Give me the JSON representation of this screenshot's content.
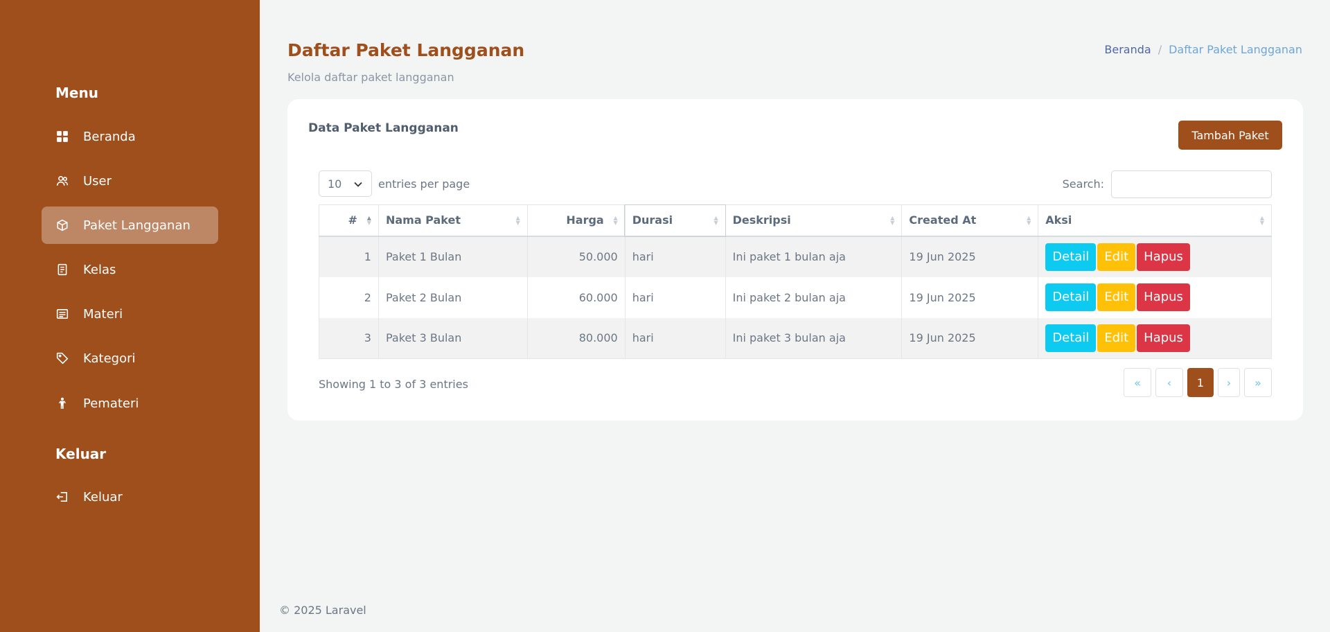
{
  "sidebar": {
    "menu_title": "Menu",
    "items": [
      {
        "label": "Beranda",
        "icon": "dashboard-icon"
      },
      {
        "label": "User",
        "icon": "users-icon"
      },
      {
        "label": "Paket Langganan",
        "icon": "box-icon",
        "active": true
      },
      {
        "label": "Kelas",
        "icon": "class-icon"
      },
      {
        "label": "Materi",
        "icon": "material-icon"
      },
      {
        "label": "Kategori",
        "icon": "tag-icon"
      },
      {
        "label": "Pemateri",
        "icon": "person-icon"
      }
    ],
    "logout_title": "Keluar",
    "logout_item": {
      "label": "Keluar",
      "icon": "logout-icon"
    }
  },
  "header": {
    "title": "Daftar Paket Langganan",
    "subtitle": "Kelola daftar paket langganan",
    "breadcrumb": {
      "home": "Beranda",
      "separator": "/",
      "current": "Daftar Paket Langganan"
    }
  },
  "card": {
    "title": "Data Paket Langganan",
    "add_button": "Tambah Paket",
    "entries_value": "10",
    "entries_label": "entries per page",
    "search_label": "Search:",
    "search_value": ""
  },
  "table": {
    "columns": [
      "#",
      "Nama Paket",
      "Harga",
      "Durasi",
      "Deskripsi",
      "Created At",
      "Aksi"
    ],
    "rows": [
      {
        "no": "1",
        "nama": "Paket 1 Bulan",
        "harga": "50.000",
        "durasi": "hari",
        "deskripsi": "Ini paket 1 bulan aja",
        "created": "19 Jun 2025"
      },
      {
        "no": "2",
        "nama": "Paket 2 Bulan",
        "harga": "60.000",
        "durasi": "hari",
        "deskripsi": "Ini paket 2 bulan aja",
        "created": "19 Jun 2025"
      },
      {
        "no": "3",
        "nama": "Paket 3 Bulan",
        "harga": "80.000",
        "durasi": "hari",
        "deskripsi": "Ini paket 3 bulan aja",
        "created": "19 Jun 2025"
      }
    ],
    "actions": {
      "detail": "Detail",
      "edit": "Edit",
      "delete": "Hapus"
    },
    "info": "Showing 1 to 3 of 3 entries"
  },
  "pagination": {
    "first": "«",
    "prev": "‹",
    "current": "1",
    "next": "›",
    "last": "»"
  },
  "footer": "© 2025 Laravel",
  "colors": {
    "brand": "#9e4f1c",
    "detail": "#0dcaf0",
    "edit": "#ffc107",
    "delete": "#dc3545"
  }
}
